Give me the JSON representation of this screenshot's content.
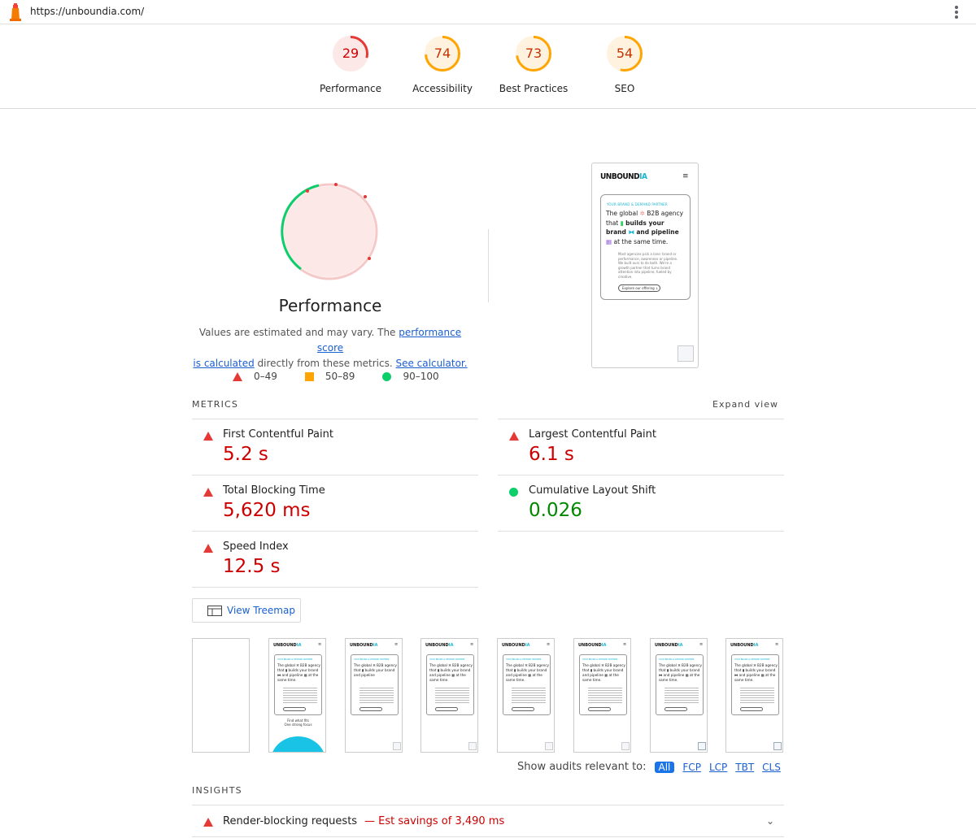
{
  "topbar": {
    "url": "https://unboundia.com/"
  },
  "scores": [
    {
      "value": "29",
      "label": "Performance",
      "fraction": 0.29,
      "color": "#e53935",
      "bg": "#fde8e8",
      "text": "#c00"
    },
    {
      "value": "74",
      "label": "Accessibility",
      "fraction": 0.74,
      "color": "#ffa400",
      "bg": "#fff3e0",
      "text": "#c33300"
    },
    {
      "value": "73",
      "label": "Best Practices",
      "fraction": 0.73,
      "color": "#ffa400",
      "bg": "#fff3e0",
      "text": "#c33300"
    },
    {
      "value": "54",
      "label": "SEO",
      "fraction": 0.54,
      "color": "#ffa400",
      "bg": "#fff3e0",
      "text": "#c33300"
    }
  ],
  "performance": {
    "title": "Performance",
    "desc_pre": "Values are estimated and may vary. The ",
    "desc_link1": "performance score",
    "desc_link1b": "is calculated",
    "desc_mid": " directly from these metrics. ",
    "desc_link2": "See calculator."
  },
  "legend": [
    {
      "label": "0–49",
      "icon": "triangle-red"
    },
    {
      "label": "50–89",
      "icon": "square-orange"
    },
    {
      "label": "90–100",
      "icon": "circle-green"
    }
  ],
  "phone": {
    "brand_a": "UNBOUND",
    "brand_b": "IA",
    "tag": "YOUR BRAND & DEMAND PARTNER",
    "head1": "The global ",
    "head2": " B2B agency",
    "head3": "that ",
    "head4": "builds your",
    "head5": "brand ",
    "head6": "and pipeline",
    "head7": "at the same time.",
    "body": "Most agencies pick a lane: brand or performance, awareness or pipeline. We built ours to do both. We're a growth partner that turns brand attention into pipeline, fueled by creative.",
    "cta": "Explore our offering ↓"
  },
  "metrics_heading": "METRICS",
  "expand_label": "Expand view",
  "metrics": [
    {
      "name": "First Contentful Paint",
      "value": "5.2 s",
      "status": "bad"
    },
    {
      "name": "Largest Contentful Paint",
      "value": "6.1 s",
      "status": "bad"
    },
    {
      "name": "Total Blocking Time",
      "value": "5,620 ms",
      "status": "bad"
    },
    {
      "name": "Cumulative Layout Shift",
      "value": "0.026",
      "status": "good"
    },
    {
      "name": "Speed Index",
      "value": "12.5 s",
      "status": "bad"
    }
  ],
  "treemap_label": "View Treemap",
  "filmstrip": {
    "extra_text": "Find what fits\nOne strong focus"
  },
  "show_audits": {
    "label": "Show audits relevant to:",
    "chips": [
      "All",
      "FCP",
      "LCP",
      "TBT",
      "CLS"
    ]
  },
  "insights_heading": "INSIGHTS",
  "insight": {
    "name": "Render-blocking requests",
    "savings": "— Est savings of 3,490 ms"
  },
  "colors": {
    "bad": "#c00",
    "good": "#080",
    "link": "#1a5fd0"
  }
}
